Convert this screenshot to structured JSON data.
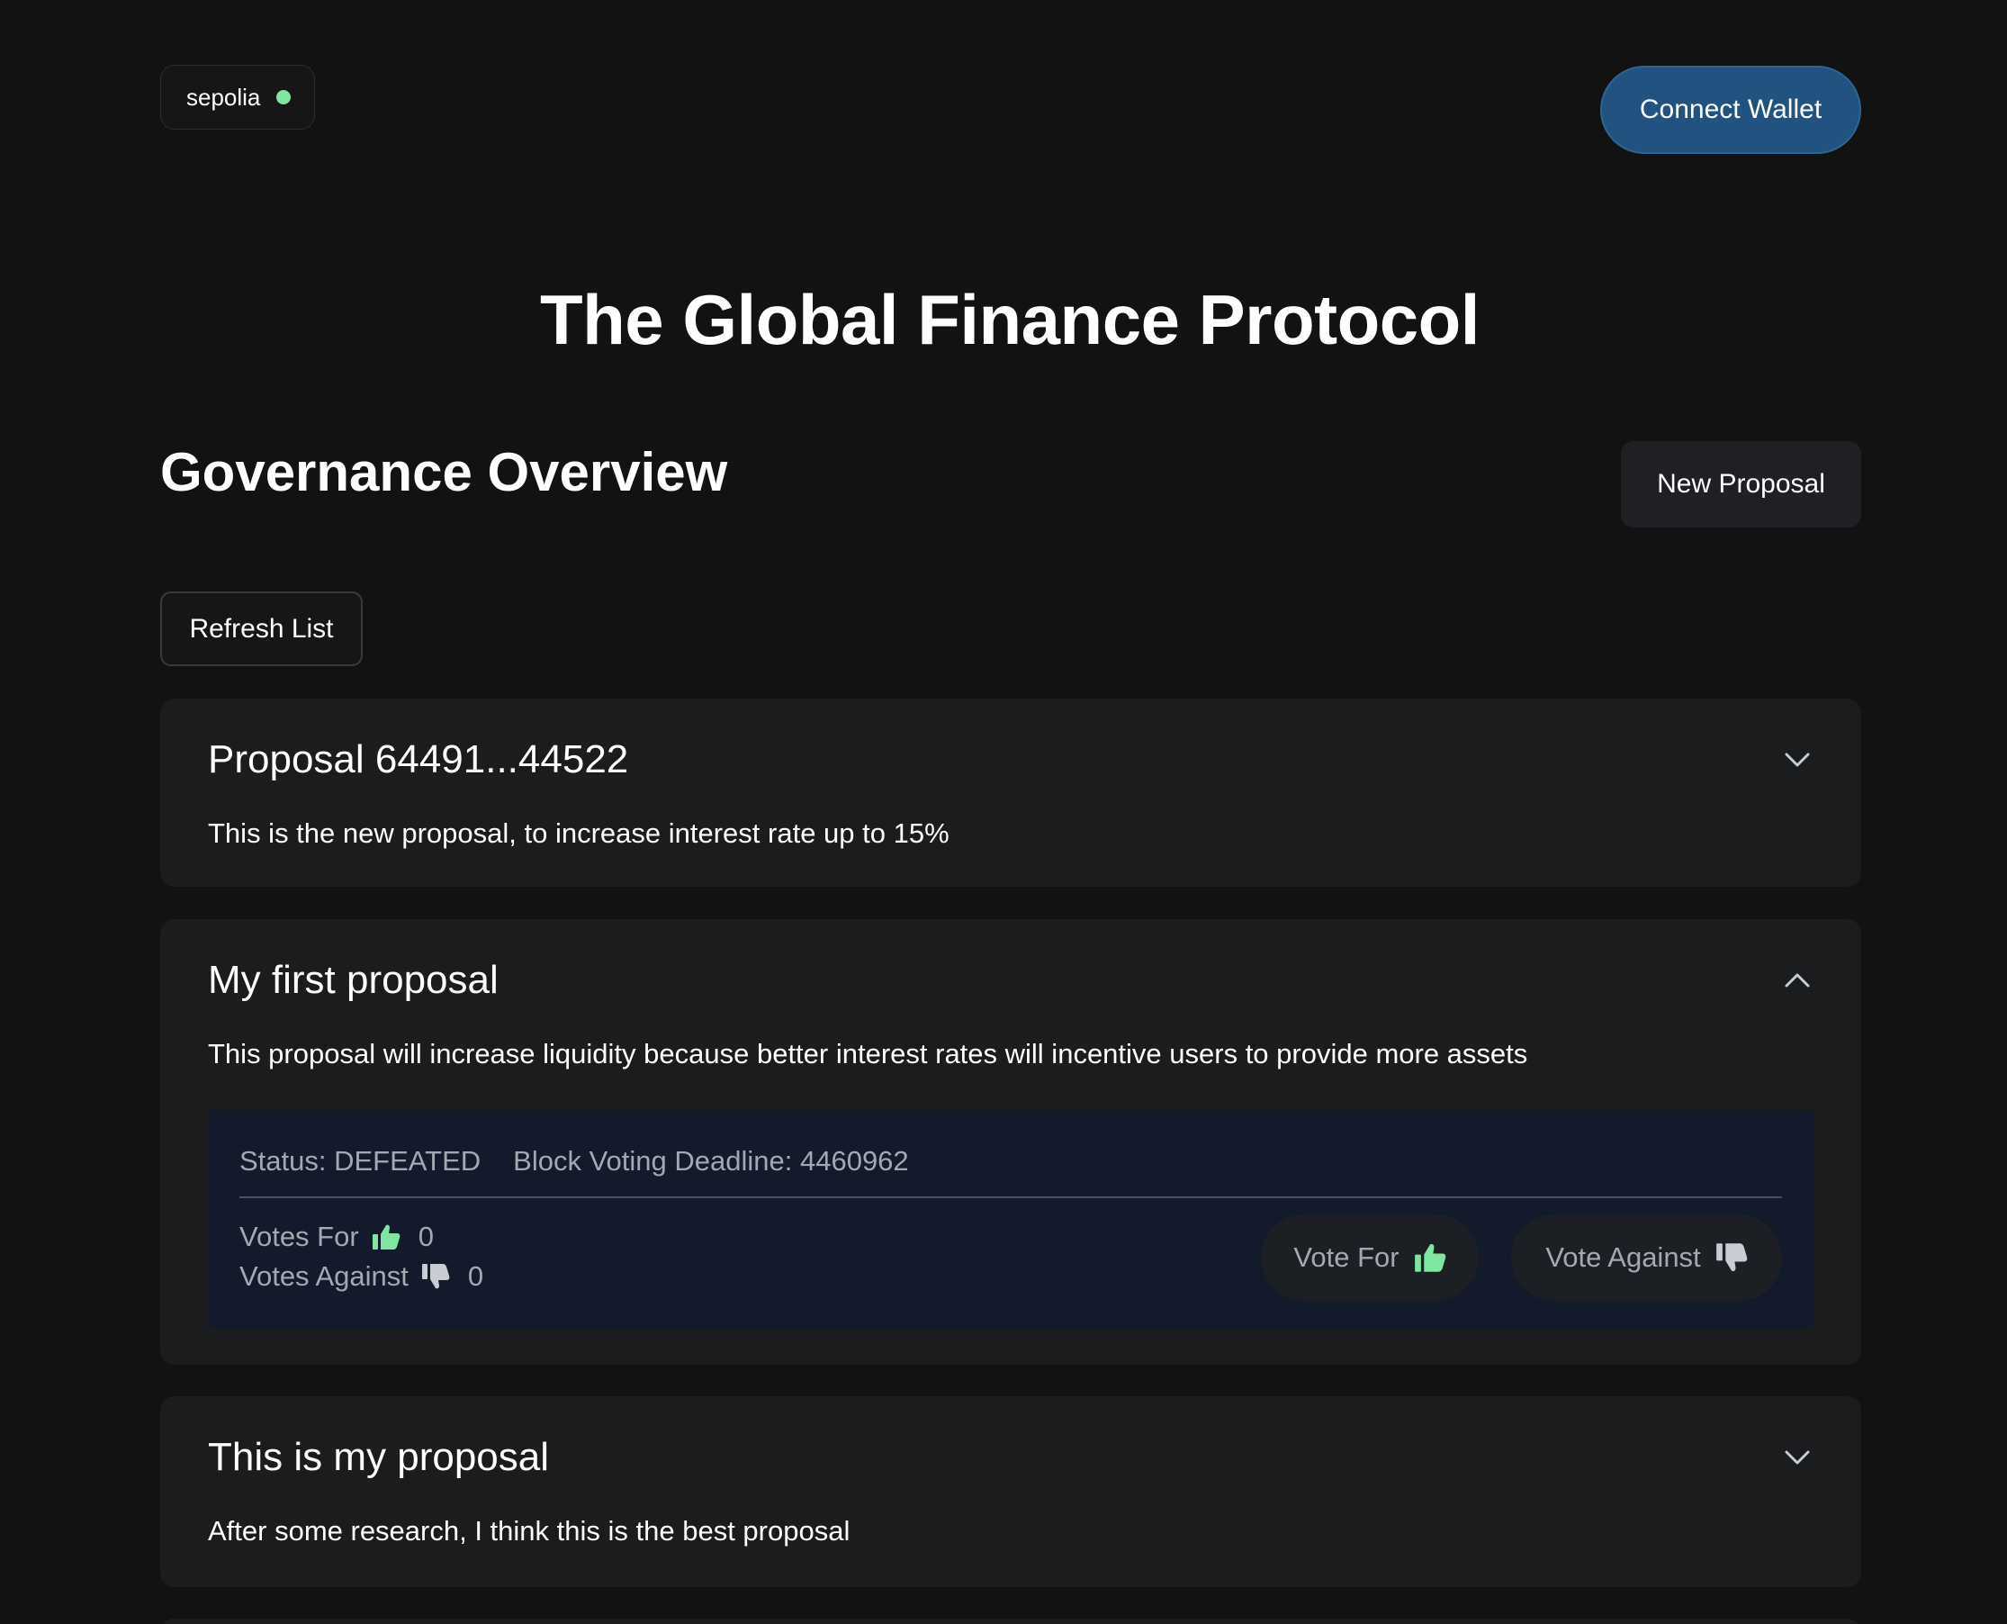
{
  "header": {
    "network_label": "sepolia",
    "connect_label": "Connect Wallet"
  },
  "app_title": "The Global Finance Protocol",
  "governance": {
    "title": "Governance Overview",
    "new_proposal_label": "New Proposal",
    "refresh_label": "Refresh List"
  },
  "proposals": [
    {
      "title": "Proposal 64491...44522",
      "description": "This is the new proposal, to increase interest rate up to 15%",
      "expanded": false
    },
    {
      "title": "My first proposal",
      "description": "This proposal will increase liquidity because better interest rates will incentive users to provide more assets",
      "expanded": true,
      "status_text": "Status: DEFEATED",
      "deadline_text": "Block Voting Deadline: 4460962",
      "votes_for_label": "Votes For",
      "votes_for_count": "0",
      "votes_against_label": "Votes Against",
      "votes_against_count": "0",
      "vote_for_button": "Vote For",
      "vote_against_button": "Vote Against"
    },
    {
      "title": "This is my proposal",
      "description": "After some research, I think this is the best proposal",
      "expanded": false
    }
  ],
  "colors": {
    "background": "#121212",
    "card": "#1b1c1e",
    "details_panel": "#121a2b",
    "connect_button": "#215280",
    "network_dot": "#7fe5a0",
    "thumb_up": "#7fe5a0",
    "thumb_down": "#c9ccd2"
  },
  "icons": {
    "expand": "chevron-down-icon",
    "collapse": "chevron-up-icon",
    "vote_for": "thumbs-up-icon",
    "vote_against": "thumbs-down-icon"
  }
}
